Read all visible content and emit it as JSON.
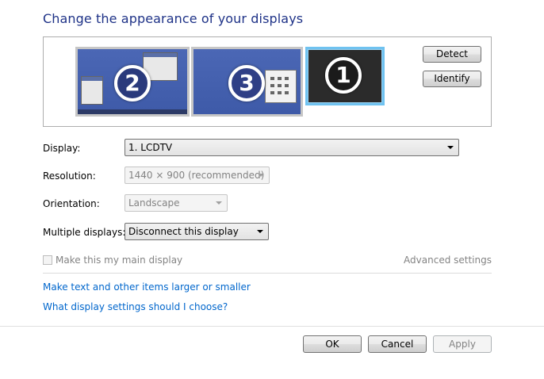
{
  "title": "Change the appearance of your displays",
  "monitors": [
    {
      "number": "2",
      "selected": false
    },
    {
      "number": "3",
      "selected": false
    },
    {
      "number": "1",
      "selected": true
    }
  ],
  "buttons": {
    "detect": "Detect",
    "identify": "Identify",
    "ok": "OK",
    "cancel": "Cancel",
    "apply": "Apply"
  },
  "fields": {
    "display": {
      "label": "Display:",
      "value": "1. LCDTV"
    },
    "resolution": {
      "label": "Resolution:",
      "value": "1440 × 900 (recommended)"
    },
    "orientation": {
      "label": "Orientation:",
      "value": "Landscape"
    },
    "multiple": {
      "label": "Multiple displays:",
      "value": "Disconnect this display"
    }
  },
  "main_display_checkbox": {
    "label": "Make this my main display",
    "checked": false
  },
  "advanced_settings": "Advanced settings",
  "links": {
    "text_size": "Make text and other items larger or smaller",
    "which_settings": "What display settings should I choose?"
  },
  "colors": {
    "title": "#1e3287",
    "link": "#0066cc",
    "selected_monitor_border": "#6fc2f0",
    "desktop_blue": "#4b67b5"
  }
}
